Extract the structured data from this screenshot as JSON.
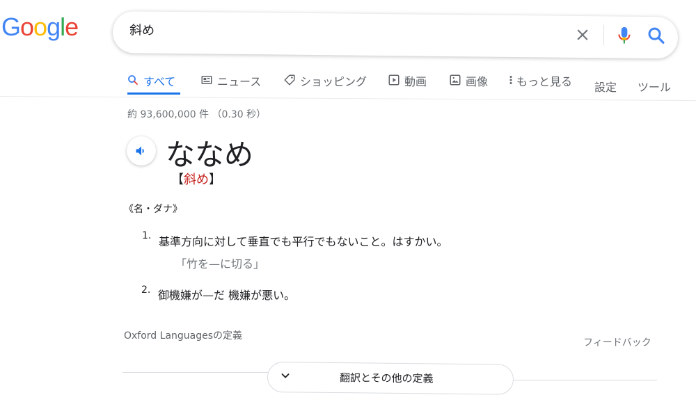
{
  "logo": {
    "letters": [
      "G",
      "o",
      "o",
      "g",
      "l",
      "e"
    ],
    "colors": [
      "#4285F4",
      "#EA4335",
      "#FBBC05",
      "#4285F4",
      "#34A853",
      "#EA4335"
    ]
  },
  "search": {
    "query": "斜め",
    "clear_icon": "close-icon",
    "mic_icon": "mic-icon",
    "search_icon": "search-icon"
  },
  "tabs": [
    {
      "label": "すべて",
      "icon": "search-icon"
    },
    {
      "label": "ニュース",
      "icon": "news-icon"
    },
    {
      "label": "ショッピング",
      "icon": "tag-icon"
    },
    {
      "label": "動画",
      "icon": "play-icon"
    },
    {
      "label": "画像",
      "icon": "image-icon"
    },
    {
      "label": "もっと見る",
      "icon": "more-vert-icon"
    },
    {
      "label": "設定",
      "icon": ""
    },
    {
      "label": "ツール",
      "icon": ""
    }
  ],
  "stats": "約 93,600,000 件 （0.30 秒）",
  "dictionary": {
    "headword": "ななめ",
    "kanji_open": "【",
    "kanji": "斜め",
    "kanji_close": "】",
    "part_of_speech": "《名・ダナ》",
    "definitions": [
      {
        "num": "1.",
        "text": "基準方向に対して垂直でも平行でもないこと。はすかい。",
        "example": "「竹を—に切る」"
      },
      {
        "num": "2.",
        "text": "御機嫌が—だ 機嫌が悪い。"
      }
    ],
    "source": "Oxford Languagesの定義",
    "feedback": "フィードバック",
    "more_button": "翻訳とその他の定義"
  },
  "accent_color": "#1a73e8",
  "highlight_color": "#c5221f"
}
